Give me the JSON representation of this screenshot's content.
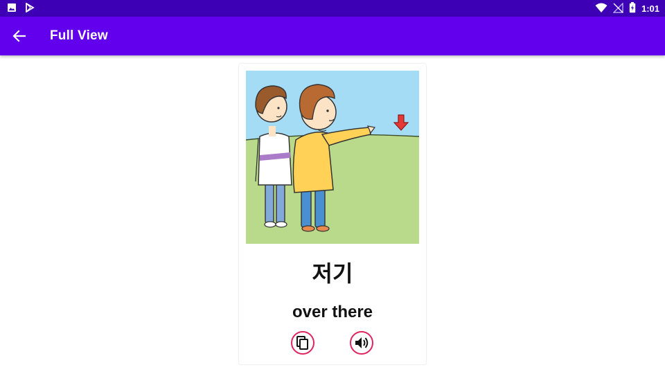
{
  "status_bar": {
    "time": "1:01",
    "left_icons": [
      "image-icon",
      "play-store-icon"
    ],
    "right_icons": [
      "wifi-icon",
      "no-signal-icon",
      "battery-charging-icon"
    ]
  },
  "app_bar": {
    "title": "Full View",
    "back_icon": "arrow-back-icon",
    "color": "#6200ee"
  },
  "card": {
    "illustration": "two-boys-pointing-over-there",
    "word": "저기",
    "meaning": "over there",
    "actions": [
      {
        "name": "copy",
        "icon": "copy-icon"
      },
      {
        "name": "speak",
        "icon": "volume-icon"
      }
    ],
    "accent_color": "#e0245e"
  }
}
